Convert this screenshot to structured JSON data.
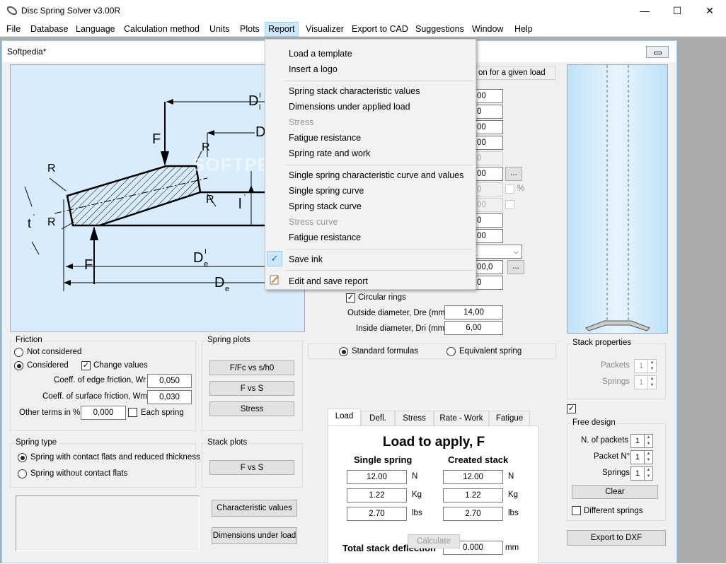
{
  "window": {
    "title": "Disc Spring Solver v3.00R"
  },
  "menubar": [
    "File",
    "Database",
    "Language",
    "Calculation method",
    "Units",
    "Plots",
    "Report",
    "Visualizer",
    "Export to CAD",
    "Suggestions",
    "Window",
    "Help"
  ],
  "child": {
    "title": "Softpedia*"
  },
  "diagram": {
    "labels": [
      "D",
      "i",
      "I",
      "D",
      "F",
      "R",
      "R",
      "R",
      "R",
      "t",
      "'",
      "l",
      "'",
      "F",
      "D",
      "e",
      "I",
      "D",
      "e"
    ]
  },
  "report_menu": {
    "items": [
      {
        "label": "Load a template",
        "enabled": true
      },
      {
        "label": "Insert a logo",
        "enabled": true
      },
      {
        "label": "Spring stack characteristic values",
        "enabled": true
      },
      {
        "label": "Dimensions under applied load",
        "enabled": true
      },
      {
        "label": "Stress",
        "enabled": false
      },
      {
        "label": "Fatigue resistance",
        "enabled": true
      },
      {
        "label": "Spring rate and work",
        "enabled": true
      },
      {
        "label": "Single spring characteristic curve and values",
        "enabled": true
      },
      {
        "label": "Single spring curve",
        "enabled": true
      },
      {
        "label": "Spring stack curve",
        "enabled": true
      },
      {
        "label": "Stress curve",
        "enabled": false
      },
      {
        "label": "Fatigue resistance",
        "enabled": true
      },
      {
        "label": "Save ink",
        "enabled": true,
        "checked": true
      },
      {
        "label": "Edit and save report",
        "enabled": true
      }
    ]
  },
  "calc_mode_tail": "on for a given load",
  "partial_values": [
    "00",
    "0",
    "00",
    "00",
    "0",
    "00",
    "0",
    "00",
    "0",
    "00",
    "0",
    "00,0",
    "0"
  ],
  "ellipsis": "...",
  "percent": "%",
  "circular_rings": {
    "label": "Circular rings",
    "checked": true
  },
  "outside_diameter": {
    "label": "Outside diameter, Dre (mm)",
    "value": "14,00"
  },
  "inside_diameter": {
    "label": "Inside diameter, Dri (mm)",
    "value": "6,00"
  },
  "formulas": {
    "standard": "Standard formulas",
    "equivalent": "Equivalent spring"
  },
  "friction": {
    "title": "Friction",
    "not_considered": "Not considered",
    "considered": "Considered",
    "change_values": "Change values",
    "edge_label": "Coeff. of edge friction, Wr",
    "edge_value": "0,050",
    "surface_label": "Coeff. of surface friction, Wm",
    "surface_value": "0,030",
    "other_label": "Other terms in %",
    "other_value": "0,000",
    "each_spring": "Each spring"
  },
  "spring_plots": {
    "title": "Spring plots",
    "buttons": [
      "F/Fc vs s/h0",
      "F vs S",
      "Stress"
    ]
  },
  "spring_type": {
    "title": "Spring type",
    "with_flats": "Spring with contact flats and reduced thickness",
    "without_flats": "Spring without contact flats"
  },
  "stack_plots": {
    "title": "Stack plots",
    "button": "F vs S"
  },
  "buttons": {
    "characteristic_values": "Characteristic values",
    "dimensions_under_load": "Dimensions under load",
    "calculate": "Calculate",
    "clear": "Clear",
    "export_dxf": "Export to DXF"
  },
  "tabs": [
    "Load",
    "Defl.",
    "Stress",
    "Rate - Work",
    "Fatigue"
  ],
  "load_panel": {
    "title": "Load to apply, F",
    "single_header": "Single spring",
    "stack_header": "Created stack",
    "rows": [
      {
        "single": "12.00",
        "stack": "12.00",
        "unit": "N"
      },
      {
        "single": "1.22",
        "stack": "1.22",
        "unit": "Kg"
      },
      {
        "single": "2.70",
        "stack": "2.70",
        "unit": "lbs"
      }
    ],
    "deflection_label": "Total stack deflection",
    "deflection_value": "0.000",
    "deflection_unit": "mm"
  },
  "stack_properties": {
    "title": "Stack properties",
    "packets_label": "Packets",
    "packets_value": "1",
    "springs_label": "Springs",
    "springs_value": "1"
  },
  "free_design": {
    "title": "Free design",
    "n_packets_label": "N. of packets",
    "n_packets_value": "1",
    "packet_no_label": "Packet N°",
    "packet_no_value": "1",
    "springs_label": "Springs",
    "springs_value": "1",
    "different_springs": "Different springs"
  },
  "watermark": "SOFTPEDIA",
  "colors": {
    "accent": "#cce8ff",
    "diagram_bg": "#d8ecfb",
    "hatch": "#000000"
  }
}
